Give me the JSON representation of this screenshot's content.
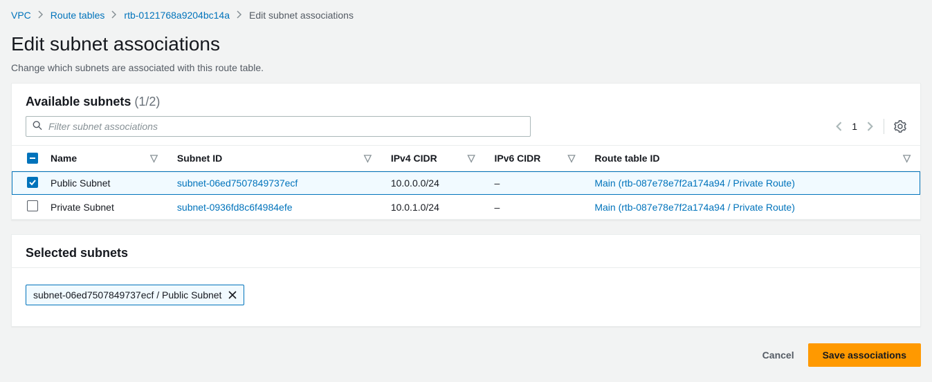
{
  "breadcrumb": {
    "vpc": "VPC",
    "route_tables": "Route tables",
    "rtb_id": "rtb-0121768a9204bc14a",
    "current": "Edit subnet associations"
  },
  "page": {
    "title": "Edit subnet associations",
    "subtitle": "Change which subnets are associated with this route table."
  },
  "available": {
    "title": "Available subnets",
    "count": "(1/2)",
    "filter_placeholder": "Filter subnet associations",
    "page_number": "1",
    "columns": {
      "name": "Name",
      "subnet_id": "Subnet ID",
      "ipv4": "IPv4 CIDR",
      "ipv6": "IPv6 CIDR",
      "route_table": "Route table ID"
    },
    "rows": [
      {
        "selected": true,
        "name": "Public Subnet",
        "subnet_id": "subnet-06ed7507849737ecf",
        "ipv4": "10.0.0.0/24",
        "ipv6": "–",
        "route_table": "Main (rtb-087e78e7f2a174a94 / Private Route)"
      },
      {
        "selected": false,
        "name": "Private Subnet",
        "subnet_id": "subnet-0936fd8c6f4984efe",
        "ipv4": "10.0.1.0/24",
        "ipv6": "–",
        "route_table": "Main (rtb-087e78e7f2a174a94 / Private Route)"
      }
    ]
  },
  "selected_panel": {
    "title": "Selected subnets",
    "chip": "subnet-06ed7507849737ecf / Public Subnet"
  },
  "actions": {
    "cancel": "Cancel",
    "save": "Save associations"
  }
}
